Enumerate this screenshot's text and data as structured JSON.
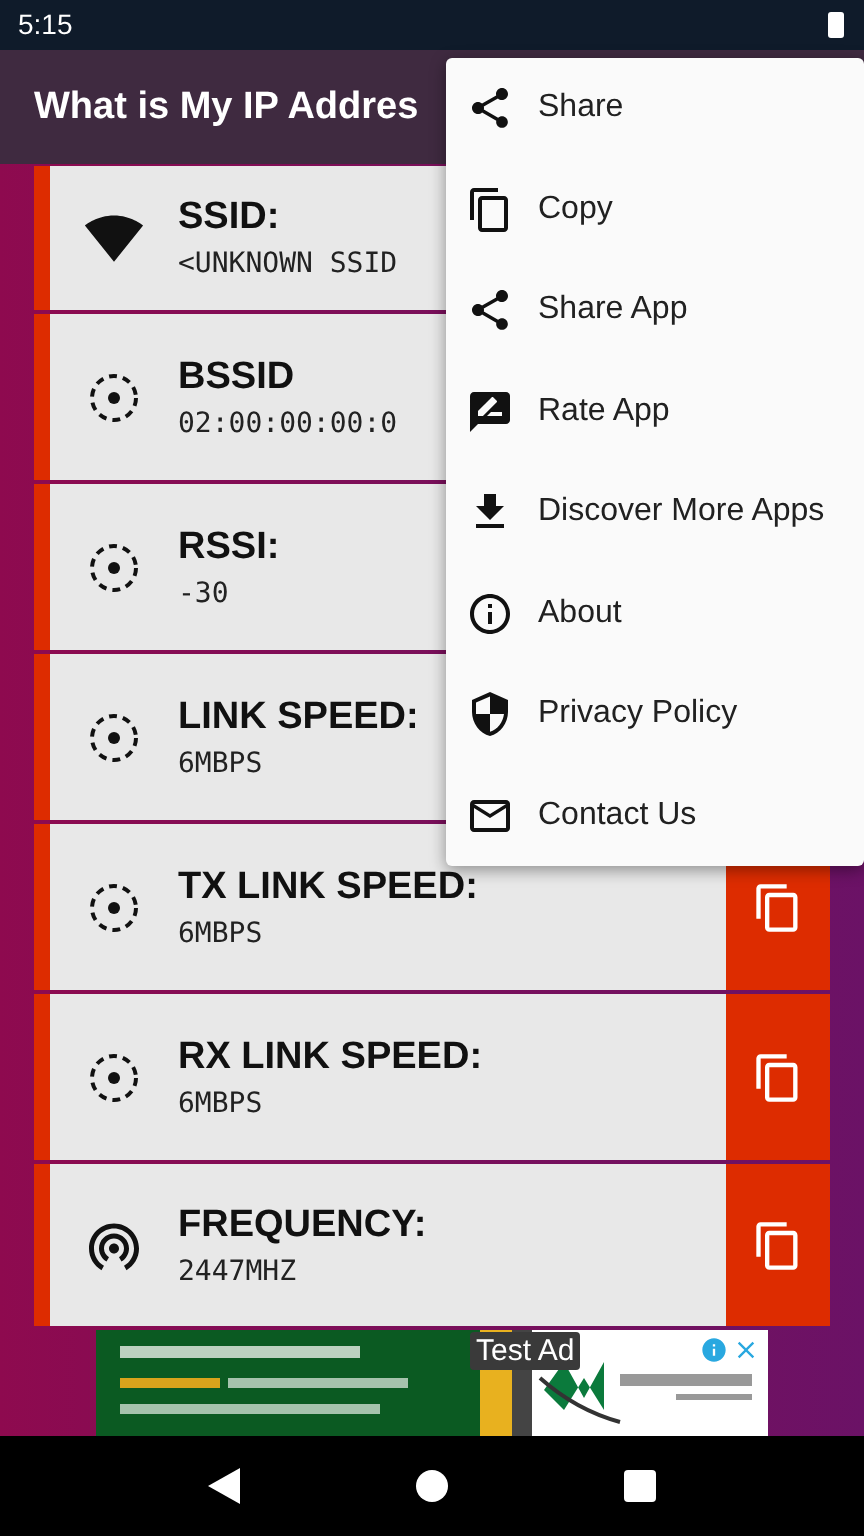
{
  "status_bar": {
    "time": "5:15"
  },
  "app_bar": {
    "title": "What is My IP Addres"
  },
  "rows": [
    {
      "kind": "wifi",
      "label": "SSID:",
      "value": "<UNKNOWN SSID"
    },
    {
      "kind": "target",
      "label": "BSSID",
      "value": "02:00:00:00:0"
    },
    {
      "kind": "target",
      "label": "RSSI:",
      "value": "-30"
    },
    {
      "kind": "target",
      "label": "LINK SPEED:",
      "value": "6MBPS"
    },
    {
      "kind": "target",
      "label": "TX LINK SPEED:",
      "value": "6MBPS",
      "copy_button": true
    },
    {
      "kind": "target",
      "label": "RX LINK SPEED:",
      "value": "6MBPS",
      "copy_button": true
    },
    {
      "kind": "broadcast",
      "label": "FREQUENCY:",
      "value": "2447MHZ",
      "copy_button": true
    }
  ],
  "menu": [
    {
      "kind": "share",
      "label": "Share"
    },
    {
      "kind": "copy",
      "label": "Copy"
    },
    {
      "kind": "share",
      "label": "Share App"
    },
    {
      "kind": "rate",
      "label": "Rate App"
    },
    {
      "kind": "download",
      "label": "Discover More Apps"
    },
    {
      "kind": "info",
      "label": "About"
    },
    {
      "kind": "shield",
      "label": "Privacy Policy"
    },
    {
      "kind": "mail",
      "label": "Contact Us"
    }
  ],
  "ad": {
    "kind": "picture",
    "badge": "Test Ad"
  }
}
